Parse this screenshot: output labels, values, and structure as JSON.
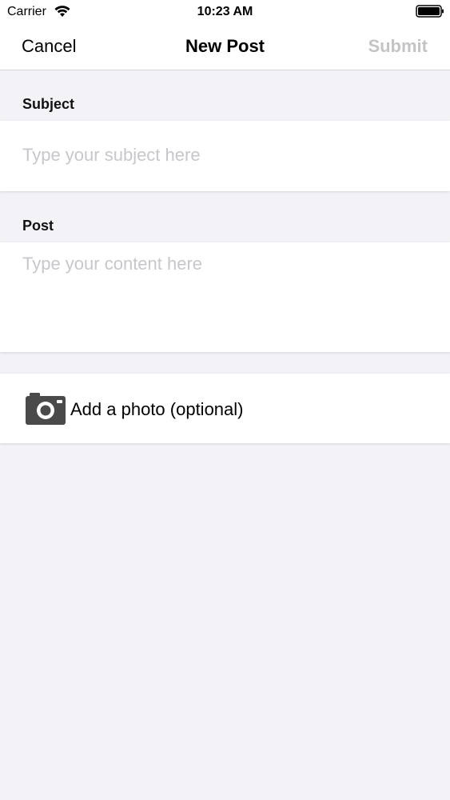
{
  "status_bar": {
    "carrier": "Carrier",
    "time": "10:23 AM",
    "icons": [
      "wifi-icon",
      "battery-icon"
    ]
  },
  "nav": {
    "cancel_label": "Cancel",
    "title": "New Post",
    "submit_label": "Submit"
  },
  "form": {
    "subject": {
      "label": "Subject",
      "value": "",
      "placeholder": "Type your subject here"
    },
    "post": {
      "label": "Post",
      "value": "",
      "placeholder": "Type your content here"
    },
    "photo": {
      "icon": "camera-icon",
      "label": "Add a photo (optional)"
    }
  },
  "colors": {
    "background": "#f3f2f7",
    "card": "#ffffff",
    "placeholder": "#c7c7cc",
    "submit_disabled": "#c4c4c7",
    "icon_dark": "#4a4a4a"
  }
}
